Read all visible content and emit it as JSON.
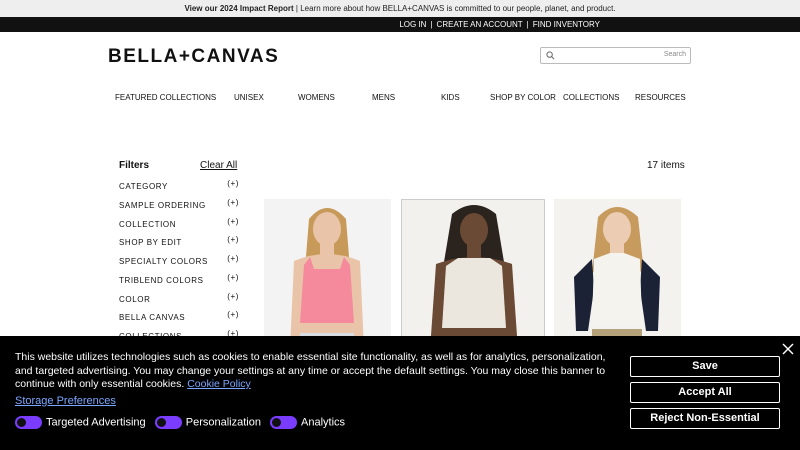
{
  "promo": {
    "bold": "View our 2024 Impact Report",
    "rest": " | Learn more about how BELLA+CANVAS is committed to our people, planet, and product."
  },
  "topbar": {
    "login": "LOG IN",
    "create": "CREATE AN ACCOUNT",
    "find": "FIND INVENTORY",
    "sep": "|"
  },
  "logo": "BELLA+CANVAS",
  "search": {
    "placeholder": "Search"
  },
  "nav": [
    "FEATURED COLLECTIONS",
    "UNISEX",
    "WOMENS",
    "MENS",
    "KIDS",
    "SHOP BY COLOR",
    "COLLECTIONS",
    "RESOURCES"
  ],
  "filters": {
    "title": "Filters",
    "clear": "Clear All",
    "plus": "(+)",
    "items": [
      "CATEGORY",
      "SAMPLE ORDERING",
      "COLLECTION",
      "SHOP BY EDIT",
      "SPECIALTY COLORS",
      "TRIBLEND COLORS",
      "COLOR",
      "BELLA CANVAS",
      "COLLECTIONS"
    ]
  },
  "results": {
    "count": "17 items"
  },
  "products": [
    {
      "color": "#f48a9c",
      "skin": "#e9c4a8",
      "hair": "#c89a5a",
      "bottom": "#d8dde3"
    },
    {
      "color": "#ece7de",
      "skin": "#6b4a35",
      "hair": "#2b231d",
      "bottom": "#d5d8d9"
    },
    {
      "color": "#f5f3ee",
      "sleeve": "#1c2236",
      "skin": "#ecccb3",
      "hair": "#c79a5d",
      "bottom": "#b6a27a"
    }
  ],
  "cookie": {
    "message": "This website utilizes technologies such as cookies to enable essential site functionality, as well as for analytics, personalization, and targeted advertising. You may change your settings at any time or accept the default settings. You may close this banner to continue with only essential cookies. ",
    "policy_link": "Cookie Policy",
    "storage_link": "Storage Preferences",
    "toggles": [
      "Targeted Advertising",
      "Personalization",
      "Analytics"
    ],
    "save": "Save",
    "accept": "Accept All",
    "reject": "Reject Non-Essential",
    "toggle_color": "#7a3cff"
  }
}
